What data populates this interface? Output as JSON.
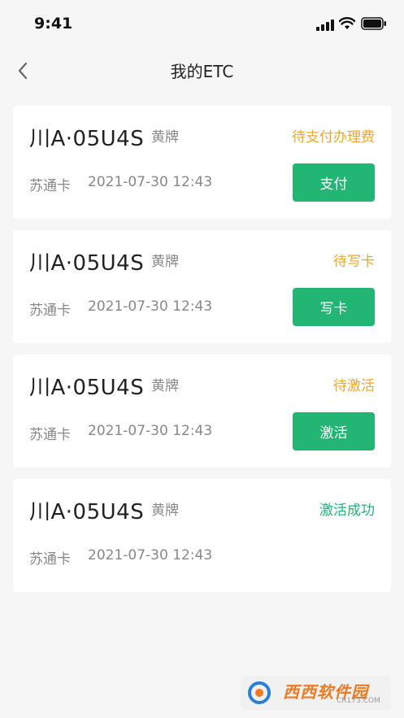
{
  "status_bar": {
    "time": "9:41"
  },
  "header": {
    "title": "我的ETC"
  },
  "cards": [
    {
      "plate": "川A·05U4S",
      "plate_type": "黄牌",
      "status": "待支付办理费",
      "status_color": "#f5a623",
      "card_type": "苏通卡",
      "datetime": "2021-07-30 12:43",
      "action": "支付"
    },
    {
      "plate": "川A·05U4S",
      "plate_type": "黄牌",
      "status": "待写卡",
      "status_color": "#f5a623",
      "card_type": "苏通卡",
      "datetime": "2021-07-30 12:43",
      "action": "写卡"
    },
    {
      "plate": "川A·05U4S",
      "plate_type": "黄牌",
      "status": "待激活",
      "status_color": "#f5a623",
      "card_type": "苏通卡",
      "datetime": "2021-07-30 12:43",
      "action": "激活"
    },
    {
      "plate": "川A·05U4S",
      "plate_type": "黄牌",
      "status": "激活成功",
      "status_color": "#22b573",
      "card_type": "苏通卡",
      "datetime": "2021-07-30 12:43",
      "action": ""
    }
  ],
  "colors": {
    "accent": "#22b573",
    "pending": "#f5a623"
  },
  "watermark": {
    "text": "西西软件园",
    "sub": "CR173.COM"
  }
}
